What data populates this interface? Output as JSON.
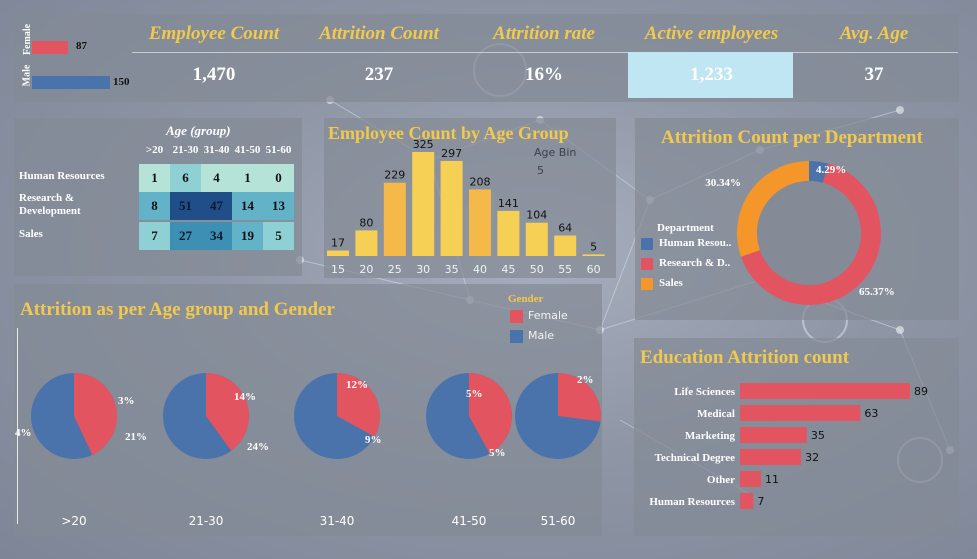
{
  "kpis": {
    "labels": [
      "Employee Count",
      "Attrition Count",
      "Attrition rate",
      "Active employees",
      "Avg. Age"
    ],
    "values": [
      "1,470",
      "237",
      "16%",
      "1,233",
      "37"
    ],
    "highlight_color": "#bfe6f2"
  },
  "gender_mini": {
    "female_label": "Female",
    "male_label": "Male",
    "female_value": 87,
    "male_value": 150,
    "female_color": "#e25560",
    "male_color": "#4a73ab"
  },
  "heatmap": {
    "title": "Age (group)",
    "columns": [
      ">20",
      "21-30",
      "31-40",
      "41-50",
      "51-60"
    ],
    "rows": [
      {
        "name": "Human Resources",
        "values": [
          1,
          6,
          4,
          1,
          0
        ]
      },
      {
        "name": "Research & Development",
        "values": [
          8,
          51,
          47,
          14,
          13
        ]
      },
      {
        "name": "Sales",
        "values": [
          7,
          27,
          34,
          19,
          5
        ]
      }
    ]
  },
  "age_chart": {
    "title": "Employee Count by Age Group",
    "legend_title": "Age Bin",
    "legend_value": "5"
  },
  "dept_chart": {
    "title": "Attrition Count per Department",
    "legend_title": "Department",
    "legend_items": [
      "Human Resou..",
      "Research & D..",
      "Sales"
    ],
    "colors": [
      "#4a73ab",
      "#e25560",
      "#f5962b"
    ],
    "labels": [
      "4.29%",
      "65.37%",
      "30.34%"
    ]
  },
  "gender_pies": {
    "title": "Attrition as per Age group and Gender",
    "legend_title": "Gender",
    "legend_items": [
      "Female",
      "Male"
    ],
    "colors": [
      "#e25560",
      "#4a73ab"
    ]
  },
  "edu_chart": {
    "title": "Education Attrition count"
  },
  "chart_data": [
    {
      "type": "bar",
      "title": "Employee Count by Age Group",
      "categories": [
        "15",
        "20",
        "25",
        "30",
        "35",
        "40",
        "45",
        "50",
        "55",
        "60"
      ],
      "values": [
        17,
        80,
        229,
        325,
        297,
        208,
        141,
        104,
        64,
        5
      ],
      "ylim": [
        0,
        360
      ]
    },
    {
      "type": "pie",
      "title": "Attrition Count per Department",
      "categories": [
        "Human Resou..",
        "Research & D..",
        "Sales"
      ],
      "values": [
        4.29,
        65.37,
        30.34
      ]
    },
    {
      "type": "pie",
      "title": "Attrition as per Age group and Gender",
      "categories": [
        ">20",
        "21-30",
        "31-40",
        "41-50",
        "51-60"
      ],
      "series": [
        {
          "name": "Female",
          "values": [
            43,
            40,
            33,
            42,
            27
          ]
        },
        {
          "name": "Male",
          "values": [
            57,
            60,
            67,
            58,
            73
          ]
        }
      ],
      "labels": [
        {
          "female": "3%",
          "male": "4%"
        },
        {
          "female": "14%",
          "male": "21%"
        },
        {
          "female": "12%",
          "male": "24%"
        },
        {
          "female": "5%",
          "male": "9%"
        },
        {
          "female": "2%",
          "male": "5%"
        }
      ]
    },
    {
      "type": "bar",
      "title": "Education Attrition count",
      "categories": [
        "Life Sciences",
        "Medical",
        "Marketing",
        "Technical Degree",
        "Other",
        "Human Resources"
      ],
      "values": [
        89,
        63,
        35,
        32,
        11,
        7
      ],
      "xlim": [
        0,
        100
      ]
    }
  ]
}
